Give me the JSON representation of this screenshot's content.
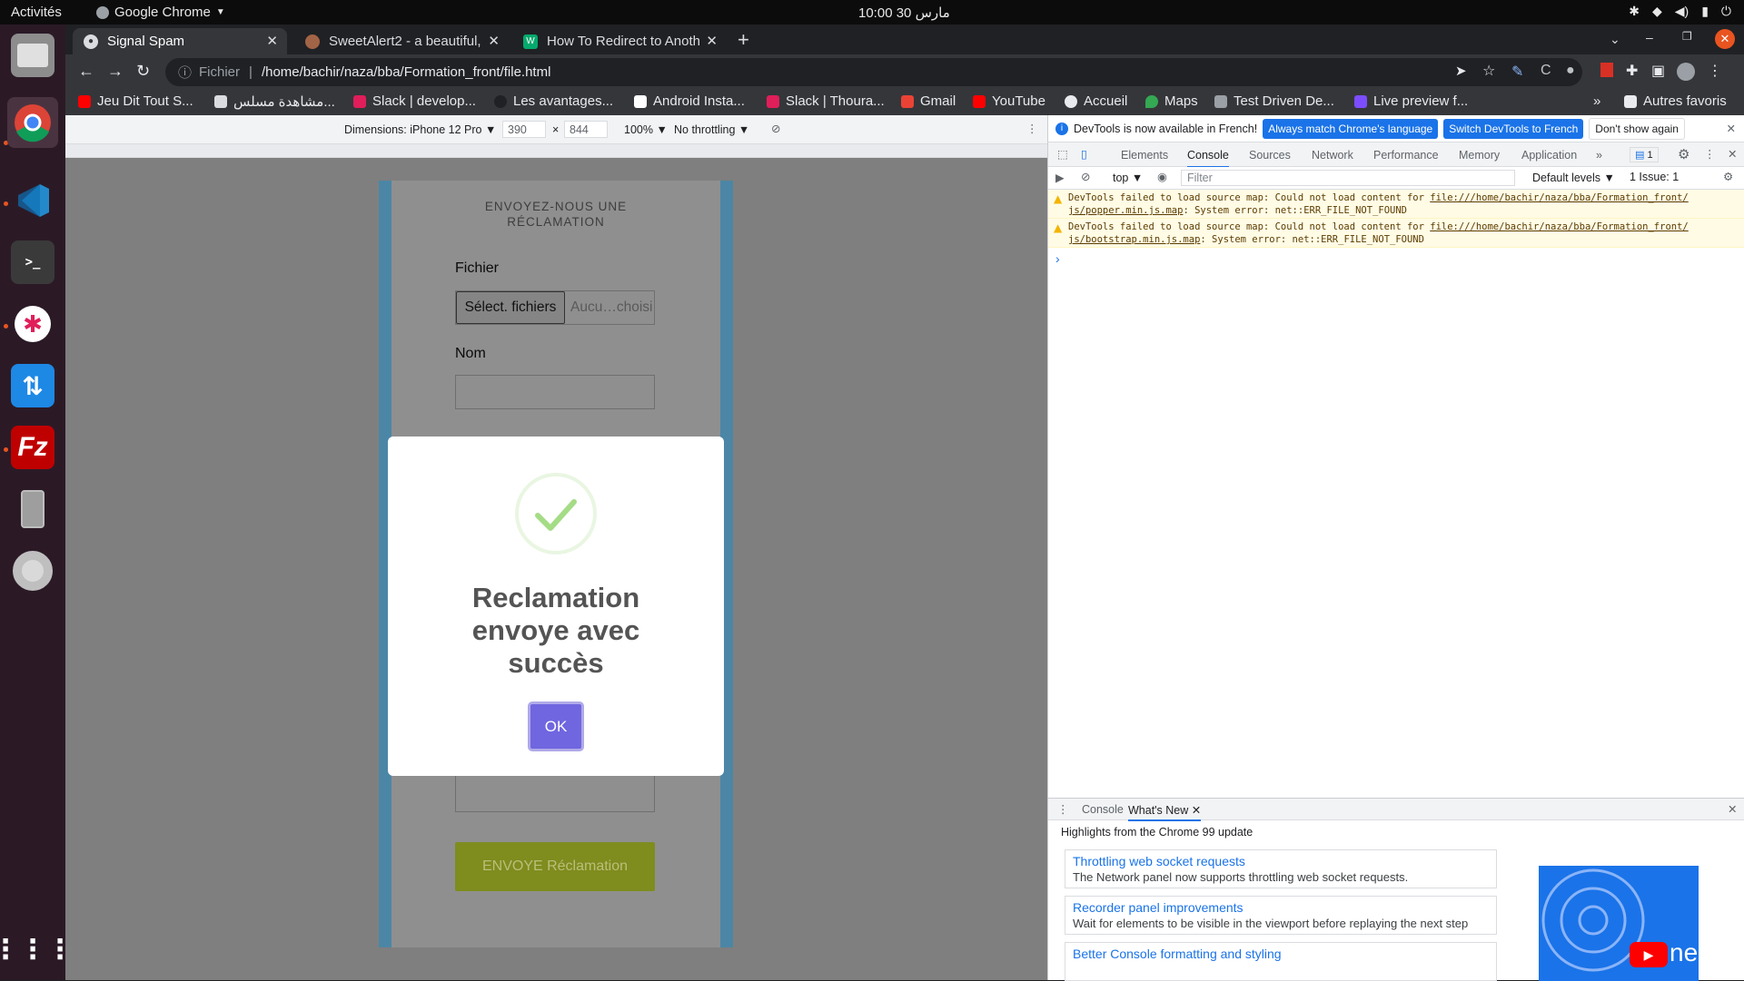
{
  "os": {
    "activities": "Activités",
    "app_menu": "Google Chrome",
    "clock": "مارس 30  10:00"
  },
  "browser": {
    "tabs": [
      {
        "title": "Signal Spam",
        "active": true
      },
      {
        "title": "SweetAlert2 - a beautiful,",
        "active": false
      },
      {
        "title": "How To Redirect to Anoth",
        "active": false
      }
    ],
    "url_prefix": "Fichier",
    "url": "/home/bachir/naza/bba/Formation_front/file.html",
    "bookmarks": [
      "Jeu Dit Tout S...",
      "مشاهدة مسلس...",
      "Slack | develop...",
      "Les avantages...",
      "Android Insta...",
      "Slack | Thoura...",
      "Gmail",
      "YouTube",
      "Accueil",
      "Maps",
      "Test Driven De...",
      "Live preview f..."
    ],
    "bookmarks_overflow": "»",
    "other_bookmarks": "Autres favoris"
  },
  "device_toolbar": {
    "dimensions_label": "Dimensions: iPhone 12 Pro ▼",
    "width": "390",
    "times": "×",
    "height": "844",
    "zoom": "100% ▼",
    "throttling": "No throttling ▼"
  },
  "page": {
    "heading_line1": "ENVOYEZ-NOUS UNE",
    "heading_line2": "RÉCLAMATION",
    "file_label": "Fichier",
    "file_button": "Sélect. fichiers",
    "file_status": "Aucu…choisi",
    "name_label": "Nom",
    "submit_label": "ENVOYE Réclamation"
  },
  "alert": {
    "title_line1": "Reclamation",
    "title_line2": "envoye avec",
    "title_line3": "succès",
    "ok_label": "OK"
  },
  "devtools": {
    "info_text": "DevTools is now available in French!",
    "btn_match": "Always match Chrome's language",
    "btn_switch": "Switch DevTools to French",
    "btn_dont_show": "Don't show again",
    "tabs": [
      "Elements",
      "Console",
      "Sources",
      "Network",
      "Performance",
      "Memory",
      "Application"
    ],
    "issues_badge": "1",
    "context": "top ▼",
    "filter_placeholder": "Filter",
    "levels": "Default levels ▼",
    "issues": "1 Issue:  1",
    "warnings": [
      {
        "prefix": "DevTools failed to load source map: Could not load content for ",
        "link1": "file:///home/bachir/naza/bba/Formation_front/",
        "link2": "js/popper.min.js.map",
        "suffix": ": System error: net::ERR_FILE_NOT_FOUND"
      },
      {
        "prefix": "DevTools failed to load source map: Could not load content for ",
        "link1": "file:///home/bachir/naza/bba/Formation_front/",
        "link2": "js/bootstrap.min.js.map",
        "suffix": ": System error: net::ERR_FILE_NOT_FOUND"
      }
    ],
    "prompt": "›",
    "drawer_tabs": [
      "Console",
      "What's New"
    ],
    "drawer_heading": "Highlights from the Chrome 99 update",
    "whats_new": [
      {
        "title": "Throttling web socket requests",
        "desc": "The Network panel now supports throttling web socket requests."
      },
      {
        "title": "Recorder panel improvements",
        "desc": "Wait for elements to be visible in the viewport before replaying the next step"
      },
      {
        "title": "Better Console formatting and styling",
        "desc": ""
      }
    ],
    "video_text": "ne"
  },
  "colors": {
    "accent": "#7066e0",
    "success": "#a5dc86",
    "submit": "#7f8c1e",
    "devtools_blue": "#1a73e8"
  }
}
